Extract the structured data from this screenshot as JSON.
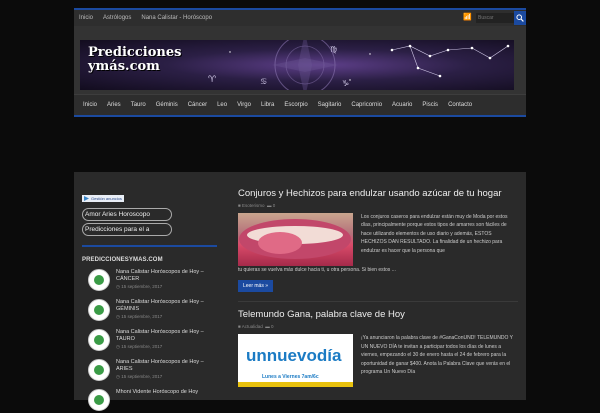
{
  "topbar": {
    "links": [
      "Inicio",
      "Astrólogos",
      "Nana Calistar - Horóscopo"
    ],
    "search_placeholder": "Buscar"
  },
  "brand": {
    "logo_line1": "Predicciones",
    "logo_line2": "ymás.com"
  },
  "nav": [
    "Inicio",
    "Aries",
    "Tauro",
    "Géminis",
    "Cáncer",
    "Leo",
    "Virgo",
    "Libra",
    "Escorpio",
    "Sagitario",
    "Capricornio",
    "Acuario",
    "Piscis",
    "Contacto"
  ],
  "sidebar": {
    "ad_label": "Gestión anuncios",
    "ad_links": [
      "Amor Aries Horoscopo",
      "Predicciones para el a"
    ],
    "widget_title": "PREDICCIONESYMAS.COM",
    "posts": [
      {
        "title": "Nana Calistar Horóscopos de Hoy – CÁNCER",
        "date": "15 septiembre, 2017"
      },
      {
        "title": "Nana Calistar Horóscopos de Hoy – GÉMINIS",
        "date": "15 septiembre, 2017"
      },
      {
        "title": "Nana Calistar Horóscopos de Hoy – TAURO",
        "date": "15 septiembre, 2017"
      },
      {
        "title": "Nana Calistar Horóscopos de Hoy – ARIES",
        "date": "15 septiembre, 2017"
      },
      {
        "title": "Mhoni Vidente Horóscopo de Hoy",
        "date": ""
      }
    ]
  },
  "articles": [
    {
      "title": "Conjuros y Hechizos para endulzar usando azúcar de tu hogar",
      "category": "Esoterismo",
      "comments": "0",
      "excerpt": "Los conjuros caseros para endulzar están muy de Moda por estos días, principalmente porque estos tipos de amarres son fáciles de hace utilizando elementos de uso diario y además, ESTOS HECHIZOS DAN RESULTADO. La finalidad de un hechizo para endulzar es hacer que la persona que",
      "excerpt_tail": "tu quieras se vuelva más dulce hacia ti, u otra persona. Si bien estos ...",
      "button": "Leer más »"
    },
    {
      "title": "Telemundo Gana, palabra clave de Hoy",
      "category": "Actualidad",
      "comments": "0",
      "excerpt": "¡Ya anunciaron la palabra clave de #GanaConUND! TELEMUNDO Y UN NUEVO DÍA te invitan a participar todos los días de lunes a viernes, empezando el 30 de enero hasta el 24 de febrero para la oportunidad de ganar $400. Anota la Palabra Clave que verás en el programa Un Nuevo Día",
      "image_logo": "unnuevodía",
      "image_sub": "Lunes a Viernes 7am/6c"
    }
  ],
  "colors": {
    "accent": "#1b4aa0"
  }
}
